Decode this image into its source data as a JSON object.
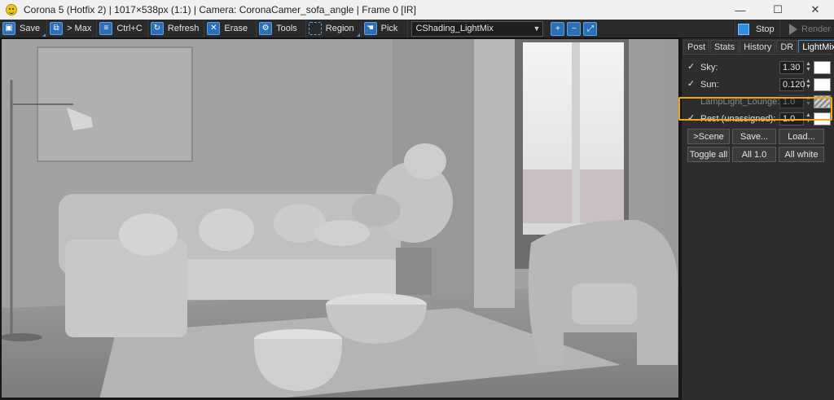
{
  "window": {
    "title": "Corona 5 (Hotfix 2) | 1017×538px (1:1) | Camera: CoronaCamer_sofa_angle | Frame 0 [IR]",
    "controls": [
      "—",
      "☐",
      "✕"
    ]
  },
  "toolbar": {
    "save": "Save",
    "max": "> Max",
    "copy": "Ctrl+C",
    "refresh": "Refresh",
    "erase": "Erase",
    "tools": "Tools",
    "region": "Region",
    "pick": "Pick",
    "pass": "CShading_LightMix",
    "stop": "Stop",
    "render": "Render"
  },
  "panel": {
    "tabs": [
      "Post",
      "Stats",
      "History",
      "DR",
      "LightMix"
    ],
    "active_tab": "LightMix",
    "rows": [
      {
        "label": "Sky:",
        "value": "1.30",
        "checked": true,
        "enabled": true
      },
      {
        "label": "Sun:",
        "value": "0.120",
        "checked": true,
        "enabled": true
      },
      {
        "label": "LampLight_Lounge:",
        "value": "1.0",
        "checked": false,
        "enabled": false
      },
      {
        "label": "Rest (unassigned):",
        "value": "1.0",
        "checked": true,
        "enabled": true
      }
    ],
    "buttons_row1": [
      ">Scene",
      "Save...",
      "Load..."
    ],
    "buttons_row2": [
      "Toggle all",
      "All 1.0",
      "All white"
    ]
  },
  "colors": {
    "accent": "#3e8fd8",
    "highlight": "#f0a512",
    "toolbar_icon": "#2b6fb8"
  }
}
